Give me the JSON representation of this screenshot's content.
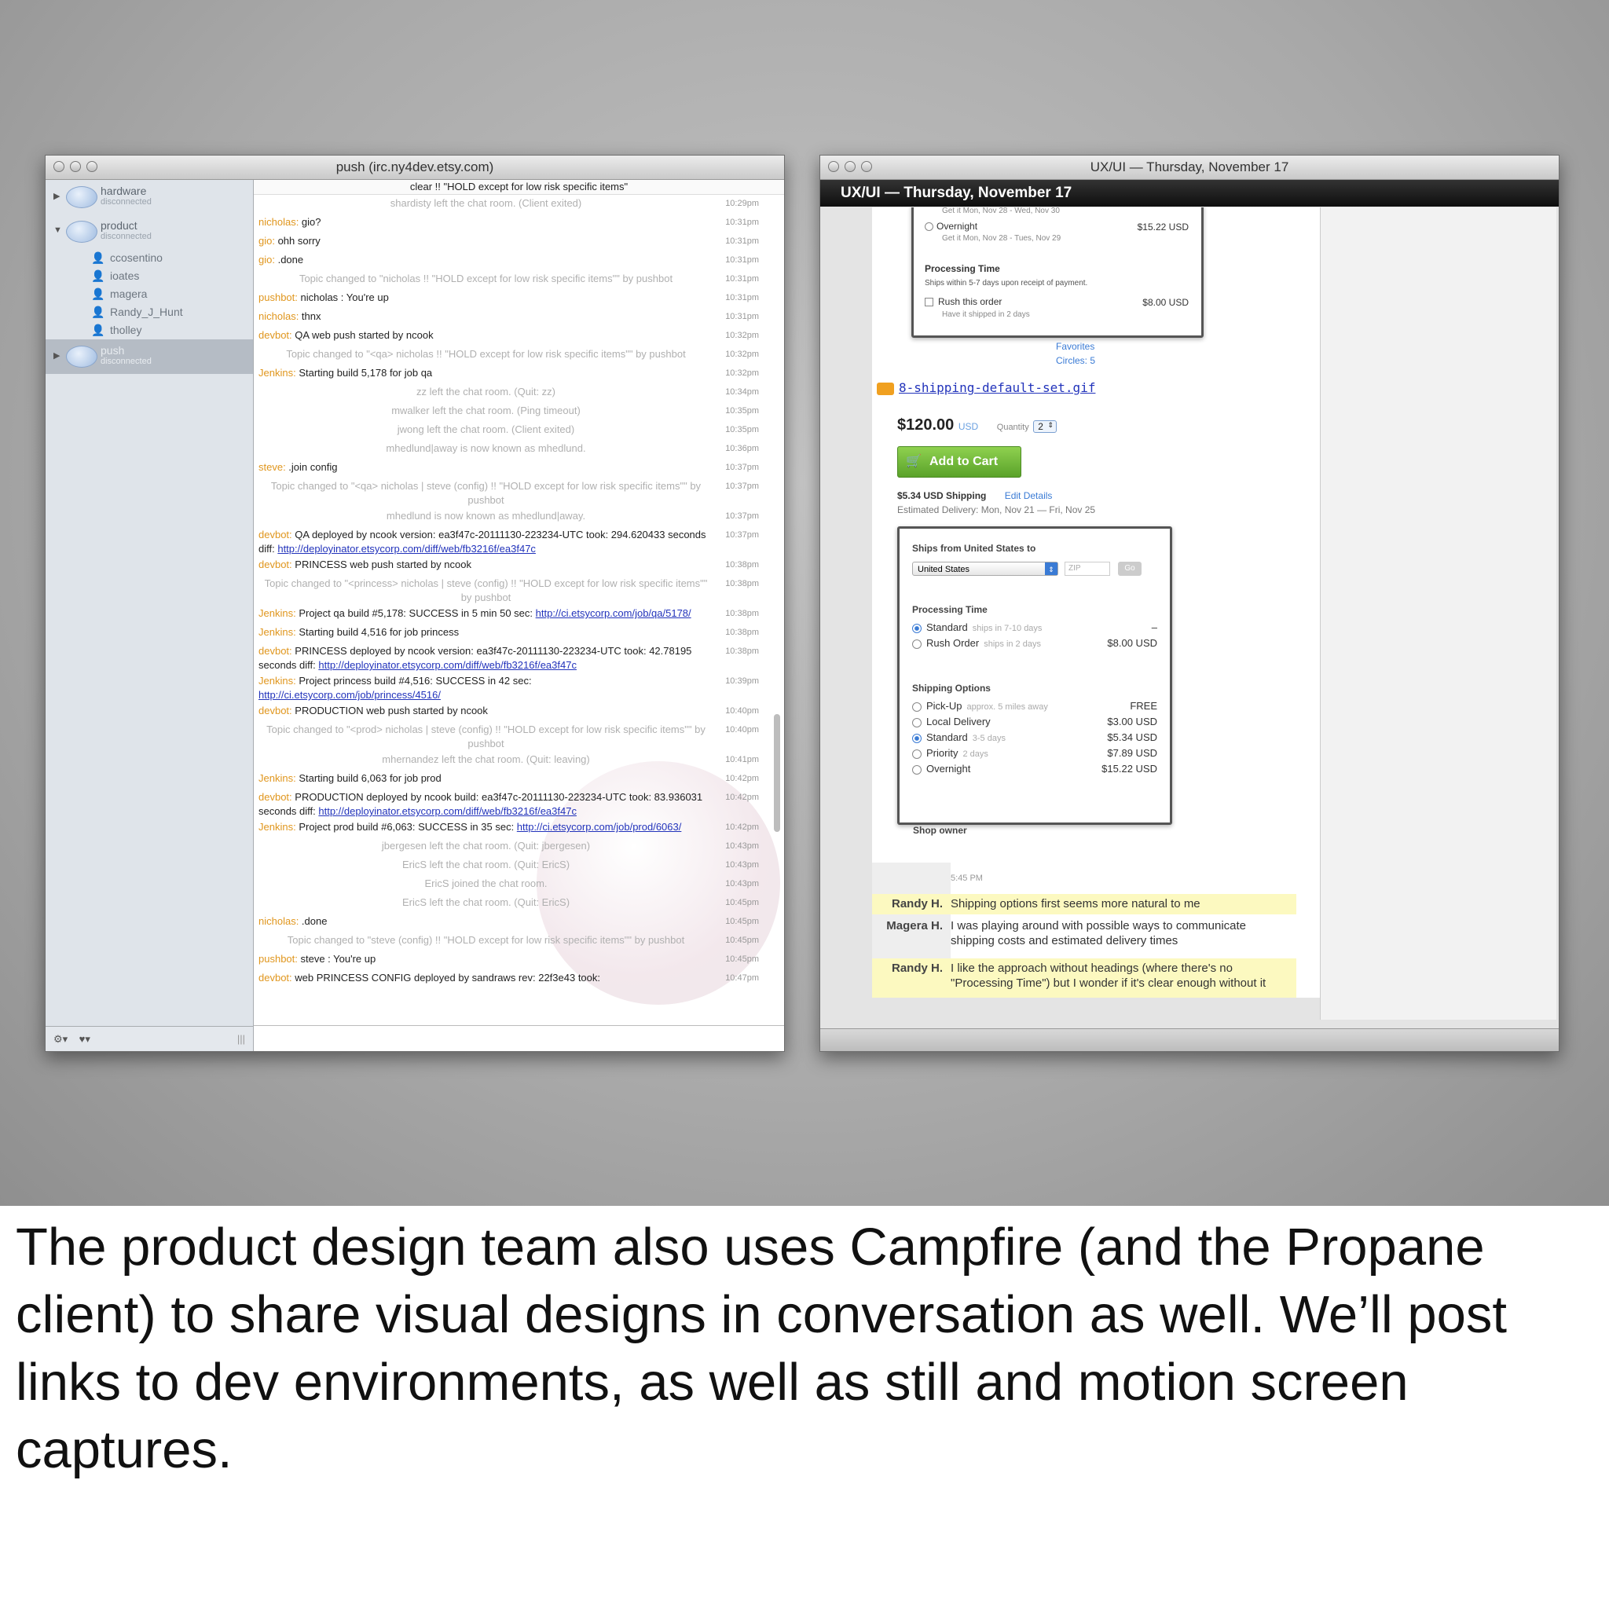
{
  "irc_window": {
    "title": "push (irc.ny4dev.etsy.com)",
    "topic": "clear !! \"HOLD except for low risk specific items\"",
    "servers": [
      {
        "name": "hardware",
        "status": "disconnected"
      },
      {
        "name": "product",
        "status": "disconnected"
      },
      {
        "name": "push",
        "status": "disconnected"
      }
    ],
    "users": [
      "ccosentino",
      "ioates",
      "magera",
      "Randy_J_Hunt",
      "tholley"
    ],
    "footer": {
      "gear": "⚙▾",
      "heart": "♥▾",
      "grip": "|||"
    },
    "messages": [
      {
        "nick": "",
        "text": "shardisty left the chat room. (Client exited)",
        "time": "10:29pm",
        "sys": true
      },
      {
        "nick": "nicholas:",
        "text": " gio?",
        "time": "10:31pm"
      },
      {
        "nick": "gio:",
        "text": " ohh sorry",
        "time": "10:31pm"
      },
      {
        "nick": "gio:",
        "text": " .done",
        "time": "10:31pm"
      },
      {
        "nick": "",
        "text": "Topic changed to \"nicholas !! \"HOLD except for low risk specific items\"\" by pushbot",
        "time": "10:31pm",
        "sys": true
      },
      {
        "nick": "pushbot:",
        "text": " nicholas : You're up",
        "time": "10:31pm"
      },
      {
        "nick": "nicholas:",
        "text": " thnx",
        "time": "10:31pm"
      },
      {
        "nick": "devbot:",
        "text": " QA web push started by ncook",
        "time": "10:32pm"
      },
      {
        "nick": "",
        "text": "Topic changed to \"<qa> nicholas !! \"HOLD except for low risk specific items\"\" by pushbot",
        "time": "10:32pm",
        "sys": true
      },
      {
        "nick": "Jenkins:",
        "text": " Starting build 5,178 for job qa",
        "time": "10:32pm"
      },
      {
        "nick": "",
        "text": "zz left the chat room. (Quit: zz)",
        "time": "10:34pm",
        "sys": true
      },
      {
        "nick": "",
        "text": "mwalker left the chat room. (Ping timeout)",
        "time": "10:35pm",
        "sys": true
      },
      {
        "nick": "",
        "text": "jwong left the chat room. (Client exited)",
        "time": "10:35pm",
        "sys": true
      },
      {
        "nick": "",
        "text": "mhedlund|away is now known as mhedlund.",
        "time": "10:36pm",
        "sys": true
      },
      {
        "nick": "steve:",
        "text": " .join config",
        "time": "10:37pm"
      },
      {
        "nick": "",
        "text": "Topic changed to \"<qa> nicholas | steve (config) !! \"HOLD except for low risk specific items\"\" by pushbot",
        "time": "10:37pm",
        "sys": true
      },
      {
        "nick": "",
        "text": "mhedlund is now known as mhedlund|away.",
        "time": "10:37pm",
        "sys": true
      },
      {
        "nick": "devbot:",
        "text": " QA deployed by ncook version: ea3f47c-20111130-223234-UTC took: 294.620433 seconds diff: ",
        "link": "http://deployinator.etsycorp.com/diff/web/fb3216f/ea3f47c",
        "time": "10:37pm"
      },
      {
        "nick": "devbot:",
        "text": " PRINCESS web push started by ncook",
        "time": "10:38pm"
      },
      {
        "nick": "",
        "text": "Topic changed to \"<princess> nicholas | steve (config) !! \"HOLD except for low risk specific items\"\" by pushbot",
        "time": "10:38pm",
        "sys": true
      },
      {
        "nick": "Jenkins:",
        "text": " Project qa build #5,178: SUCCESS in 5 min 50 sec: ",
        "link": "http://ci.etsycorp.com/job/qa/5178/",
        "time": "10:38pm"
      },
      {
        "nick": "Jenkins:",
        "text": " Starting build 4,516 for job princess",
        "time": "10:38pm"
      },
      {
        "nick": "devbot:",
        "text": " PRINCESS deployed by ncook version: ea3f47c-20111130-223234-UTC took: 42.78195 seconds diff: ",
        "link": "http://deployinator.etsycorp.com/diff/web/fb3216f/ea3f47c",
        "time": "10:38pm"
      },
      {
        "nick": "Jenkins:",
        "text": " Project princess build #4,516: SUCCESS in 42 sec: ",
        "link": "http://ci.etsycorp.com/job/princess/4516/",
        "time": "10:39pm"
      },
      {
        "nick": "devbot:",
        "text": " PRODUCTION web push started by ncook",
        "time": "10:40pm"
      },
      {
        "nick": "",
        "text": "Topic changed to \"<prod> nicholas | steve (config) !! \"HOLD except for low risk specific items\"\" by pushbot",
        "time": "10:40pm",
        "sys": true
      },
      {
        "nick": "",
        "text": "mhernandez left the chat room. (Quit: leaving)",
        "time": "10:41pm",
        "sys": true
      },
      {
        "nick": "Jenkins:",
        "text": " Starting build 6,063 for job prod",
        "time": "10:42pm"
      },
      {
        "nick": "devbot:",
        "text": " PRODUCTION deployed by ncook build: ea3f47c-20111130-223234-UTC took: 83.936031 seconds diff: ",
        "link": "http://deployinator.etsycorp.com/diff/web/fb3216f/ea3f47c",
        "time": "10:42pm"
      },
      {
        "nick": "Jenkins:",
        "text": " Project prod build #6,063: SUCCESS in 35 sec: ",
        "link": "http://ci.etsycorp.com/job/prod/6063/",
        "time": "10:42pm"
      },
      {
        "nick": "",
        "text": "jbergesen left the chat room. (Quit: jbergesen)",
        "time": "10:43pm",
        "sys": true
      },
      {
        "nick": "",
        "text": "EricS left the chat room. (Quit: EricS)",
        "time": "10:43pm",
        "sys": true
      },
      {
        "nick": "",
        "text": "EricS joined the chat room.",
        "time": "10:43pm",
        "sys": true
      },
      {
        "nick": "",
        "text": "EricS left the chat room. (Quit: EricS)",
        "time": "10:45pm",
        "sys": true
      },
      {
        "nick": "nicholas:",
        "text": " .done",
        "time": "10:45pm"
      },
      {
        "nick": "",
        "text": "Topic changed to \"steve (config) !! \"HOLD except for low risk specific items\"\" by pushbot",
        "time": "10:45pm",
        "sys": true
      },
      {
        "nick": "pushbot:",
        "text": " steve : You're up",
        "time": "10:45pm"
      },
      {
        "nick": "devbot:",
        "text": " web PRINCESS CONFIG deployed by sandraws rev: 22f3e43 took:",
        "time": "10:47pm"
      }
    ]
  },
  "ux_window": {
    "title": "UX/UI — Thursday, November 17",
    "room_header": "UX/UI — Thursday, November 17",
    "mock_top": {
      "get_it_1": "Get it Mon, Nov 28 - Wed, Nov 30",
      "overnight_label": "Overnight",
      "overnight_price": "$15.22 USD",
      "overnight_sub": "Get it Mon, Nov 28 - Tues, Nov 29",
      "processing_title": "Processing Time",
      "processing_text": "Ships within 5-7 days upon receipt of payment.",
      "rush_label": "Rush this order",
      "rush_price": "$8.00 USD",
      "rush_sub": "Have it shipped in 2 days",
      "favorites": "Favorites",
      "circles": "Circles: 5"
    },
    "attachment": "8-shipping-default-set.gif",
    "product": {
      "price": "$120.00",
      "currency": "USD",
      "quantity_label": "Quantity",
      "quantity": "2",
      "add_to_cart": "Add to Cart",
      "shipping": "$5.34 USD Shipping",
      "edit_details": "Edit Details",
      "estimated": "Estimated Delivery: Mon, Nov 21 — Fri, Nov 25"
    },
    "popup": {
      "ships_from": "Ships from United States to",
      "country": "United States",
      "zip_placeholder": "ZIP",
      "go": "Go",
      "processing_title": "Processing Time",
      "processing": [
        {
          "label": "Standard",
          "sub": "ships in 7-10 days",
          "price": "–",
          "on": true
        },
        {
          "label": "Rush Order",
          "sub": "ships in 2 days",
          "price": "$8.00 USD",
          "on": false
        }
      ],
      "shipping_title": "Shipping Options",
      "shipping": [
        {
          "label": "Pick-Up",
          "sub": "approx. 5 miles away",
          "price": "FREE",
          "on": false
        },
        {
          "label": "Local Delivery",
          "sub": "",
          "price": "$3.00 USD",
          "on": false
        },
        {
          "label": "Standard",
          "sub": "3-5 days",
          "price": "$5.34 USD",
          "on": true
        },
        {
          "label": "Priority",
          "sub": "2 days",
          "price": "$7.89 USD",
          "on": false
        },
        {
          "label": "Overnight",
          "sub": "",
          "price": "$15.22 USD",
          "on": false
        }
      ],
      "shop_owner": "Shop owner"
    },
    "chat": {
      "timestamp": "5:45 PM",
      "lines": [
        {
          "who": "Randy H.",
          "msg": "Shipping options first seems more natural to me",
          "hl": true
        },
        {
          "who": "Magera H.",
          "msg": "I was playing around with possible ways to communicate shipping costs and estimated delivery times",
          "hl": false
        },
        {
          "who": "Randy H.",
          "msg": "I like the approach without headings (where there's no \"Processing Time\") but I wonder if it's clear enough without it",
          "hl": true
        }
      ]
    }
  },
  "caption": "The product design team also uses Campfire (and the Propane client) to share visual designs in conversation as well. We’ll post links to dev environments, as well as still and motion screen captures."
}
